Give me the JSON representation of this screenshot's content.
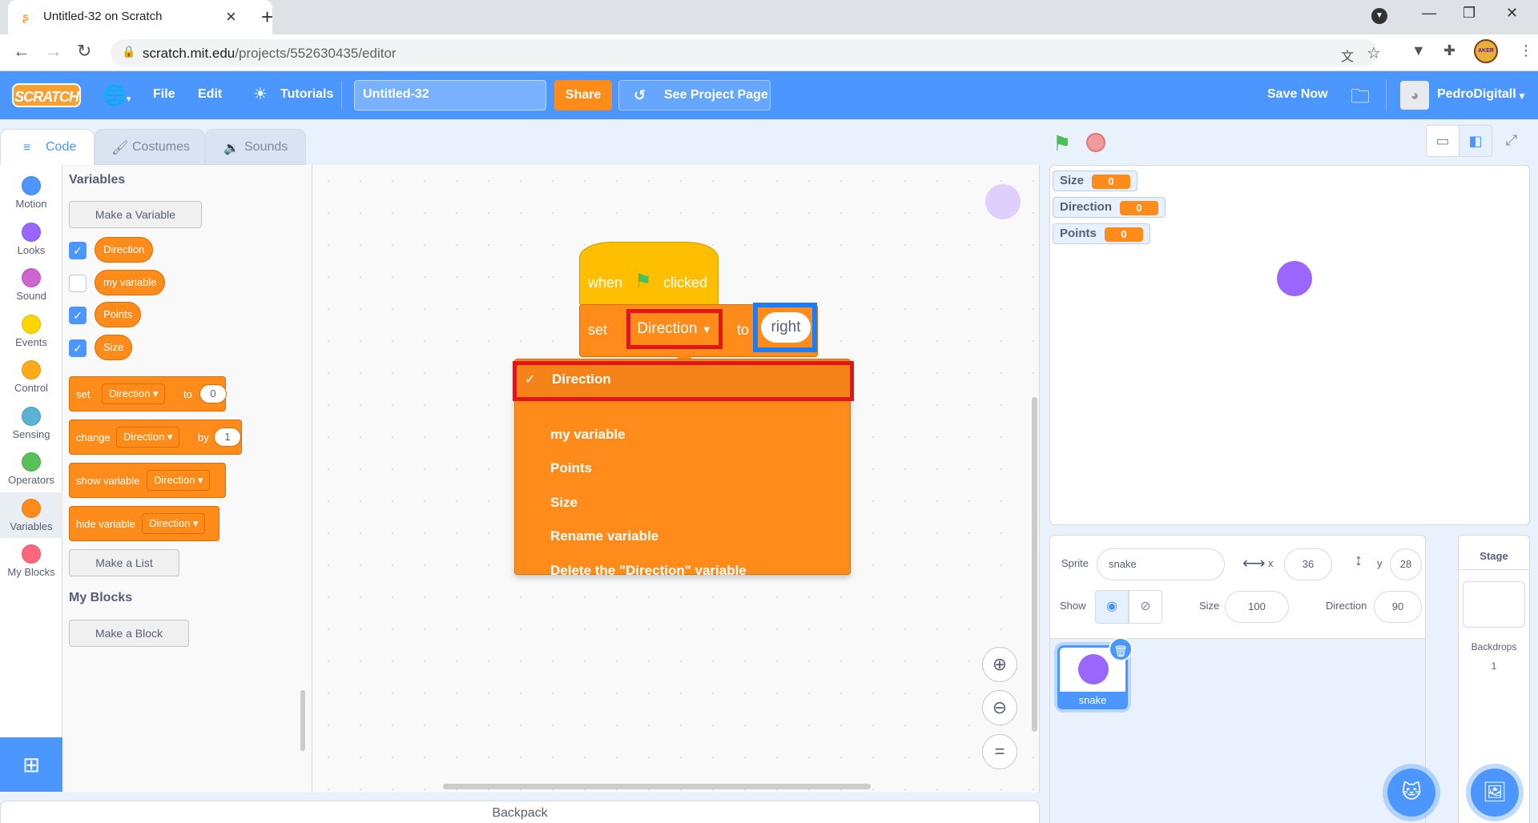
{
  "browser": {
    "tab_title": "Untitled-32 on Scratch",
    "url_domain": "scratch.mit.edu",
    "url_path": "/projects/552630435/editor",
    "profile_text": "AKER"
  },
  "menubar": {
    "logo": "SCRATCH",
    "file": "File",
    "edit": "Edit",
    "tutorials": "Tutorials",
    "project_name": "Untitled-32",
    "share": "Share",
    "see_project": "See Project Page",
    "save_now": "Save Now",
    "username": "PedroDigitall"
  },
  "editor_tabs": {
    "code": "Code",
    "costumes": "Costumes",
    "sounds": "Sounds"
  },
  "categories": [
    {
      "label": "Motion",
      "color": "#4c97ff"
    },
    {
      "label": "Looks",
      "color": "#9966ff"
    },
    {
      "label": "Sound",
      "color": "#cf63cf"
    },
    {
      "label": "Events",
      "color": "#ffd500"
    },
    {
      "label": "Control",
      "color": "#ffab19"
    },
    {
      "label": "Sensing",
      "color": "#5cb1d6"
    },
    {
      "label": "Operators",
      "color": "#59c059"
    },
    {
      "label": "Variables",
      "color": "#ff8c1a"
    },
    {
      "label": "My Blocks",
      "color": "#ff6680"
    }
  ],
  "palette": {
    "variables_title": "Variables",
    "make_variable": "Make a Variable",
    "variables": [
      {
        "name": "Direction",
        "checked": true
      },
      {
        "name": "my variable",
        "checked": false
      },
      {
        "name": "Points",
        "checked": true
      },
      {
        "name": "Size",
        "checked": true
      }
    ],
    "set_block": {
      "word": "set",
      "var": "Direction",
      "to": "to",
      "value": "0"
    },
    "change_block": {
      "word": "change",
      "var": "Direction",
      "by": "by",
      "value": "1"
    },
    "show_block": {
      "word": "show variable",
      "var": "Direction"
    },
    "hide_block": {
      "word": "hide variable",
      "var": "Direction"
    },
    "make_list": "Make a List",
    "myblocks_title": "My Blocks",
    "make_block": "Make a Block"
  },
  "script": {
    "hat_when": "when",
    "hat_clicked": "clicked",
    "set_word": "set",
    "set_var": "Direction",
    "set_to": "to",
    "set_value": "right"
  },
  "dropdown": {
    "items": [
      {
        "label": "Direction",
        "checked": true
      },
      {
        "label": "my variable",
        "checked": false
      },
      {
        "label": "Points",
        "checked": false
      },
      {
        "label": "Size",
        "checked": false
      },
      {
        "label": "Rename variable",
        "checked": false
      },
      {
        "label": "Delete the \"Direction\" variable",
        "checked": false
      }
    ],
    "check_glyph": "✓"
  },
  "backpack": "Backpack",
  "monitors": [
    {
      "name": "Size",
      "value": "0"
    },
    {
      "name": "Direction",
      "value": "0"
    },
    {
      "name": "Points",
      "value": "0"
    }
  ],
  "sprite_info": {
    "sprite_label": "Sprite",
    "sprite_name": "snake",
    "x_label": "x",
    "x_value": "36",
    "y_label": "y",
    "y_value": "28",
    "show_label": "Show",
    "size_label": "Size",
    "size_value": "100",
    "direction_label": "Direction",
    "direction_value": "90"
  },
  "sprites": [
    {
      "name": "snake"
    }
  ],
  "stage_panel": {
    "title": "Stage",
    "backdrops_label": "Backdrops",
    "backdrops_count": "1"
  }
}
